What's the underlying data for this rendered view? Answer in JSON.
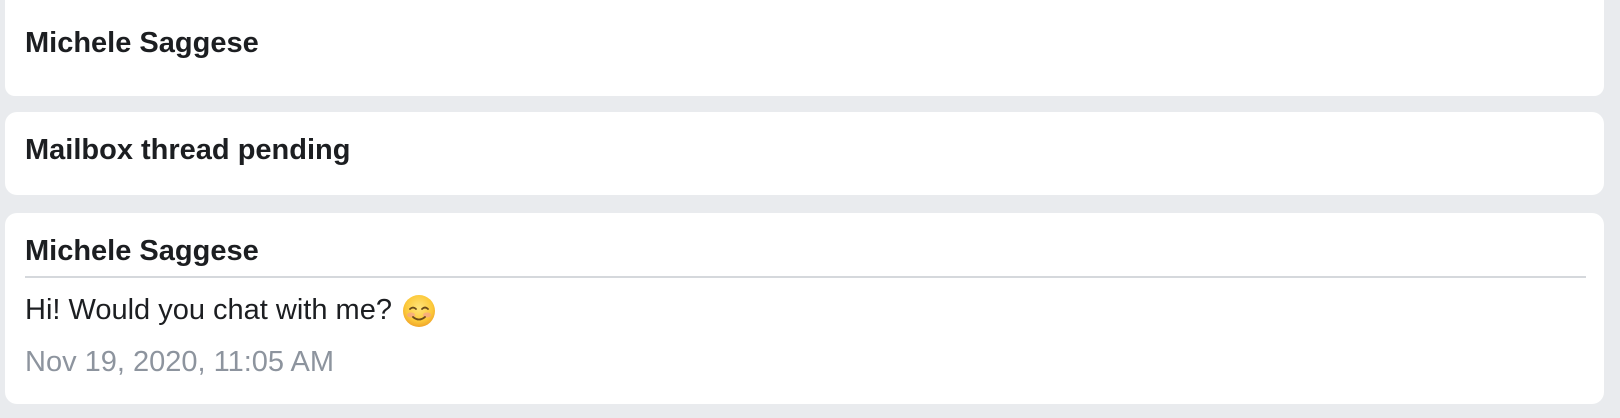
{
  "cards": [
    {
      "sender": "Michele Saggese"
    },
    {
      "status": "Mailbox thread pending"
    },
    {
      "sender": "Michele Saggese",
      "message": "Hi! Would you chat with me?",
      "emoji": "smiling-face-with-smiling-eyes-icon",
      "timestamp": "Nov 19, 2020, 11:05 AM"
    }
  ]
}
